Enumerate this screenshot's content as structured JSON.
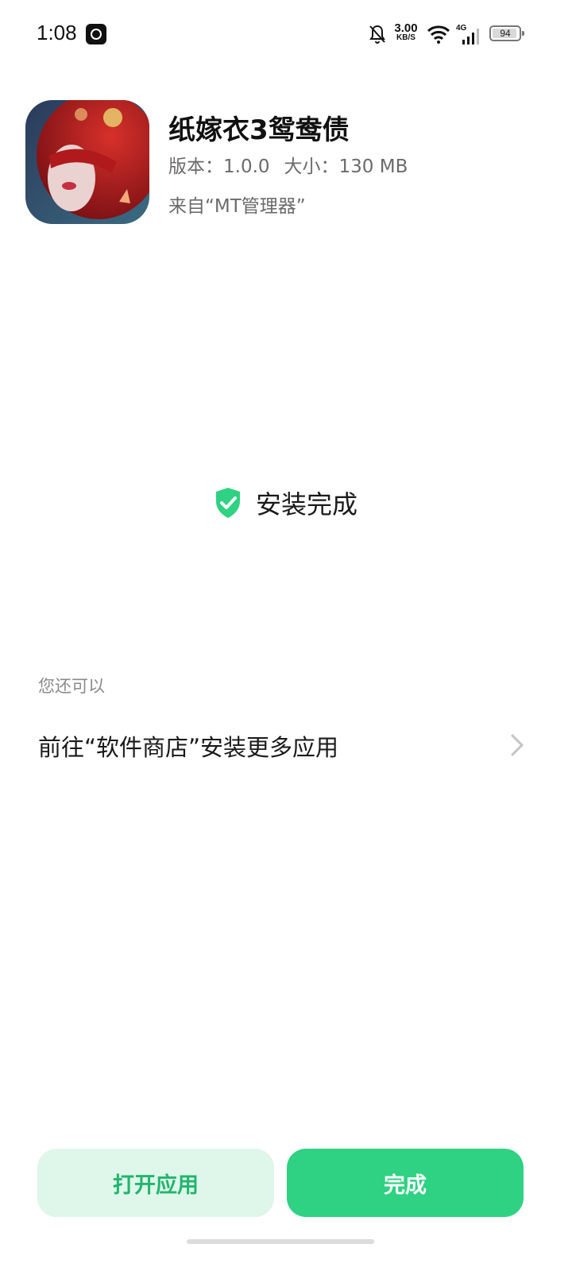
{
  "status_bar": {
    "time": "1:08",
    "net_speed_value": "3.00",
    "net_speed_unit": "KB/S",
    "network_type": "4G",
    "battery_level": "94",
    "icons": [
      "app-notification-icon",
      "bell-muted-icon",
      "wifi-icon",
      "signal-icon",
      "battery-icon"
    ]
  },
  "app": {
    "name": "纸嫁衣3鸳鸯债",
    "version": "版本：1.0.0",
    "size": "大小：130 MB",
    "source": "来自“MT管理器”"
  },
  "install": {
    "status_text": "安装完成",
    "status_icon": "shield-check-icon",
    "accent_color": "#2ed282"
  },
  "suggestions": {
    "label": "您还可以",
    "items": [
      {
        "text": "前往“软件商店”安装更多应用",
        "icon": "chevron-right-icon"
      }
    ]
  },
  "buttons": {
    "open_label": "打开应用",
    "done_label": "完成",
    "open_bg": "#dff6ea",
    "done_bg": "#2ed282"
  }
}
